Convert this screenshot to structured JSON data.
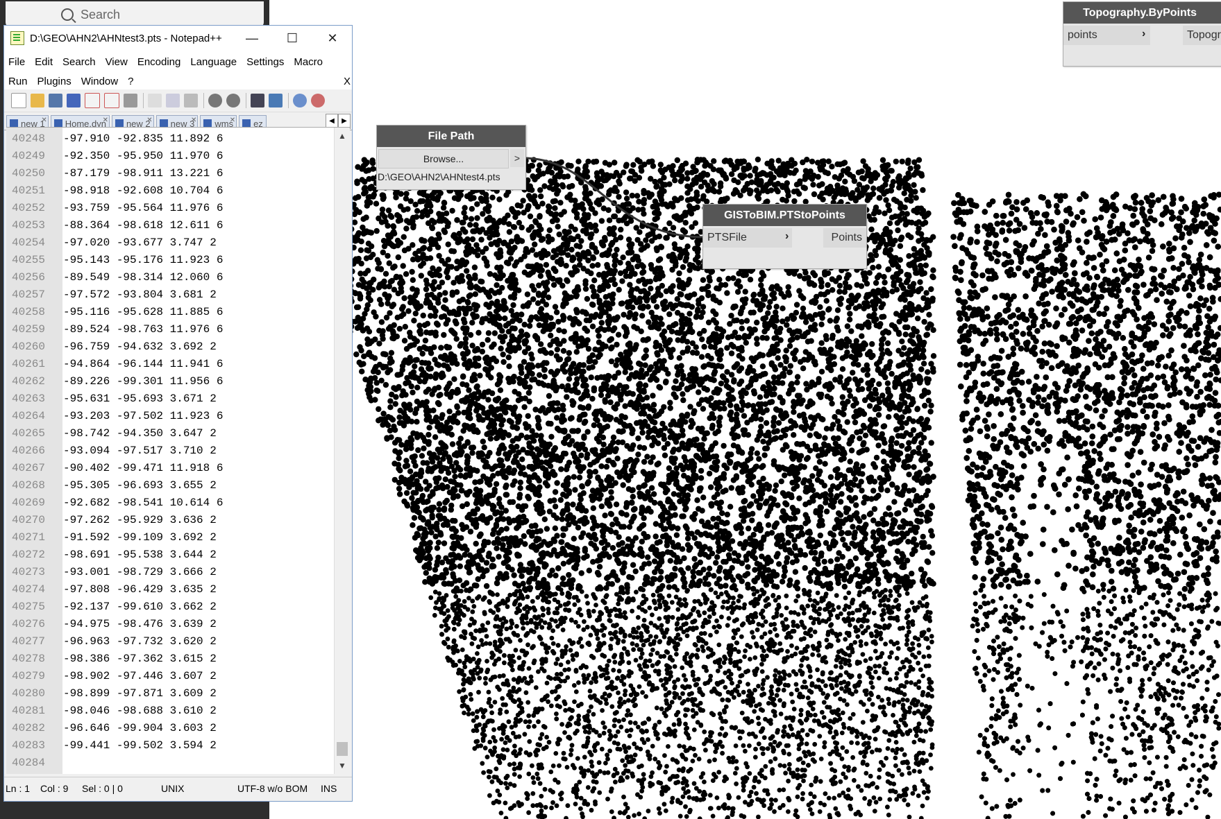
{
  "search": {
    "placeholder": "Search"
  },
  "notepad": {
    "title": "D:\\GEO\\AHN2\\AHNtest3.pts - Notepad++",
    "window_controls": {
      "minimize": "—",
      "maximize": "☐",
      "close": "✕"
    },
    "menu_row1": [
      "File",
      "Edit",
      "Search",
      "View",
      "Encoding",
      "Language",
      "Settings",
      "Macro"
    ],
    "menu_row2": [
      "Run",
      "Plugins",
      "Window",
      "?"
    ],
    "menu_close": "X",
    "tabs": [
      {
        "label": "new 1"
      },
      {
        "label": "Home.dyn"
      },
      {
        "label": "new 2"
      },
      {
        "label": "new 3"
      },
      {
        "label": "wms"
      },
      {
        "label": "ez"
      }
    ],
    "lines": [
      {
        "n": "40248",
        "t": "-97.910 -92.835 11.892 6"
      },
      {
        "n": "40249",
        "t": "-92.350 -95.950 11.970 6"
      },
      {
        "n": "40250",
        "t": "-87.179 -98.911 13.221 6"
      },
      {
        "n": "40251",
        "t": "-98.918 -92.608 10.704 6"
      },
      {
        "n": "40252",
        "t": "-93.759 -95.564 11.976 6"
      },
      {
        "n": "40253",
        "t": "-88.364 -98.618 12.611 6"
      },
      {
        "n": "40254",
        "t": "-97.020 -93.677 3.747 2"
      },
      {
        "n": "40255",
        "t": "-95.143 -95.176 11.923 6"
      },
      {
        "n": "40256",
        "t": "-89.549 -98.314 12.060 6"
      },
      {
        "n": "40257",
        "t": "-97.572 -93.804 3.681 2"
      },
      {
        "n": "40258",
        "t": "-95.116 -95.628 11.885 6"
      },
      {
        "n": "40259",
        "t": "-89.524 -98.763 11.976 6"
      },
      {
        "n": "40260",
        "t": "-96.759 -94.632 3.692 2"
      },
      {
        "n": "40261",
        "t": "-94.864 -96.144 11.941 6"
      },
      {
        "n": "40262",
        "t": "-89.226 -99.301 11.956 6"
      },
      {
        "n": "40263",
        "t": "-95.631 -95.693 3.671 2"
      },
      {
        "n": "40264",
        "t": "-93.203 -97.502 11.923 6"
      },
      {
        "n": "40265",
        "t": "-98.742 -94.350 3.647 2"
      },
      {
        "n": "40266",
        "t": "-93.094 -97.517 3.710 2"
      },
      {
        "n": "40267",
        "t": "-90.402 -99.471 11.918 6"
      },
      {
        "n": "40268",
        "t": "-95.305 -96.693 3.655 2"
      },
      {
        "n": "40269",
        "t": "-92.682 -98.541 10.614 6"
      },
      {
        "n": "40270",
        "t": "-97.262 -95.929 3.636 2"
      },
      {
        "n": "40271",
        "t": "-91.592 -99.109 3.692 2"
      },
      {
        "n": "40272",
        "t": "-98.691 -95.538 3.644 2"
      },
      {
        "n": "40273",
        "t": "-93.001 -98.729 3.666 2"
      },
      {
        "n": "40274",
        "t": "-97.808 -96.429 3.635 2"
      },
      {
        "n": "40275",
        "t": "-92.137 -99.610 3.662 2"
      },
      {
        "n": "40276",
        "t": "-94.975 -98.476 3.639 2"
      },
      {
        "n": "40277",
        "t": "-96.963 -97.732 3.620 2"
      },
      {
        "n": "40278",
        "t": "-98.386 -97.362 3.615 2"
      },
      {
        "n": "40279",
        "t": "-98.902 -97.446 3.607 2"
      },
      {
        "n": "40280",
        "t": "-98.899 -97.871 3.609 2"
      },
      {
        "n": "40281",
        "t": "-98.046 -98.688 3.610 2"
      },
      {
        "n": "40282",
        "t": "-96.646 -99.904 3.603 2"
      },
      {
        "n": "40283",
        "t": "-99.441 -99.502 3.594 2"
      },
      {
        "n": "40284",
        "t": ""
      }
    ],
    "status": {
      "ln": "Ln : 1",
      "col": "Col : 9",
      "sel": "Sel : 0 | 0",
      "eol": "UNIX",
      "encoding": "UTF-8 w/o BOM",
      "mode": "INS"
    }
  },
  "nodes": {
    "file_path": {
      "title": "File Path",
      "button": "Browse...",
      "output_arrow": ">",
      "value": "D:\\GEO\\AHN2\\AHNtest4.pts"
    },
    "pts_to_points": {
      "title": "GISToBIM.PTStoPoints",
      "input": "PTSFile",
      "output": "Points"
    },
    "topography": {
      "title": "Topography.ByPoints",
      "input": "points",
      "output": "Topogr"
    }
  },
  "colors": {
    "node_header": "#565656",
    "point_cloud": "#000000",
    "wire": "#333333",
    "sidebar": "#2e2e2e"
  }
}
